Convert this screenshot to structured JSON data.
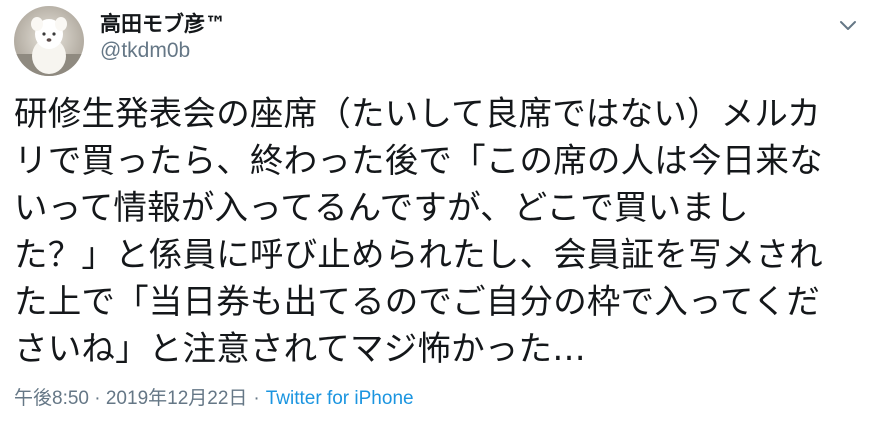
{
  "tweet": {
    "author": {
      "display_name": "高田モブ彦™",
      "handle": "@tkdm0b"
    },
    "text": "研修生発表会の座席（たいして良席ではない）メルカ\nリで買ったら、終わった後で「この席の人は今日来な\nいって情報が入ってるんですが、どこで買いまし\nた？」と係員に呼び止められたし、会員証を写メされ\nた上で「当日券も出てるのでご自分の枠で入ってくだ\nさいね」と注意されてマジ怖かった…",
    "timestamp": "午後8:50 · 2019年12月22日",
    "separator": "·",
    "source": "Twitter for iPhone"
  },
  "icons": {
    "avatar": "avatar-photo",
    "menu": "chevron-down-icon"
  },
  "colors": {
    "text": "#14171a",
    "secondary": "#657786",
    "link": "#1b95e0"
  }
}
